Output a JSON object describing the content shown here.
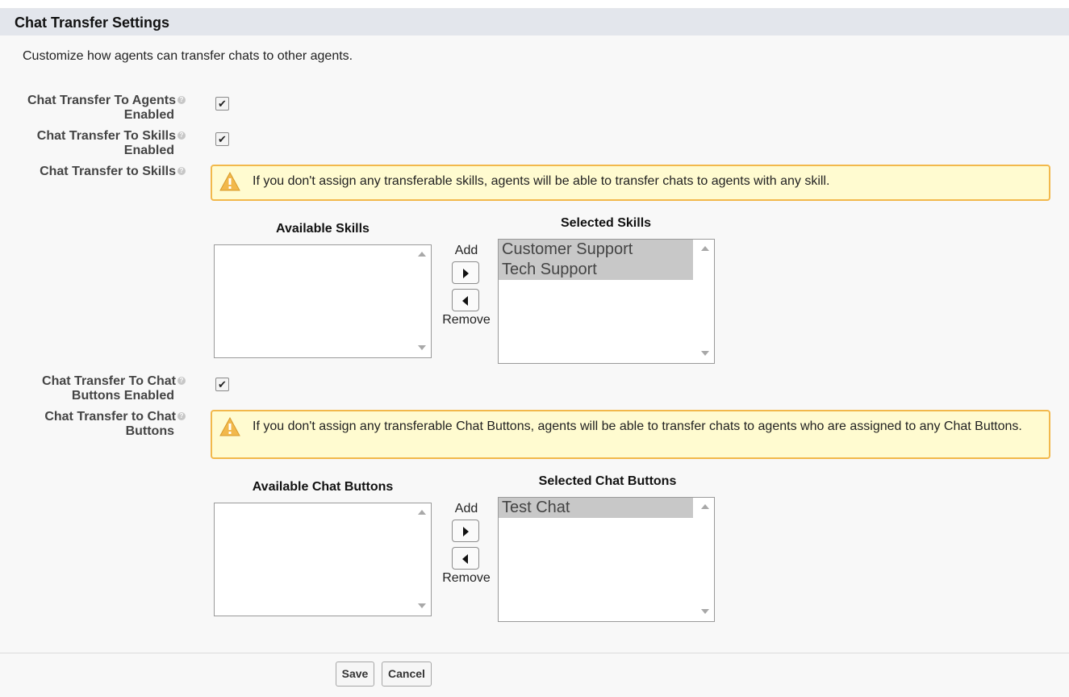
{
  "section": {
    "title": "Chat Transfer Settings",
    "description": "Customize how agents can transfer chats to other agents."
  },
  "fields": {
    "agents_enabled": {
      "label_line1": "Chat Transfer To Agents",
      "label_line2": "Enabled",
      "checked": true
    },
    "skills_enabled": {
      "label_line1": "Chat Transfer To Skills",
      "label_line2": "Enabled",
      "checked": true
    },
    "skills": {
      "label": "Chat Transfer to Skills"
    },
    "buttons_enabled": {
      "label_line1": "Chat Transfer To Chat",
      "label_line2": "Buttons Enabled",
      "checked": true
    },
    "buttons": {
      "label_line1": "Chat Transfer to Chat",
      "label_line2": "Buttons"
    }
  },
  "warnings": {
    "skills": "If you don't assign any transferable skills, agents will be able to transfer chats to agents with any skill.",
    "buttons": "If you don't assign any transferable Chat Buttons, agents will be able to transfer chats to agents who are assigned to any Chat Buttons."
  },
  "skills_picker": {
    "available_title": "Available Skills",
    "selected_title": "Selected Skills",
    "available": [],
    "selected": [
      "Customer Support",
      "Tech Support"
    ],
    "add_label": "Add",
    "remove_label": "Remove"
  },
  "buttons_picker": {
    "available_title": "Available Chat Buttons",
    "selected_title": "Selected Chat Buttons",
    "available": [],
    "selected": [
      "Test Chat"
    ],
    "add_label": "Add",
    "remove_label": "Remove"
  },
  "footer": {
    "save_label": "Save",
    "cancel_label": "Cancel"
  },
  "colors": {
    "header_bg": "#e3e6ec",
    "warning_bg": "#fffbd0",
    "warning_border": "#f2b84b",
    "warning_icon": "#f2b84b",
    "selected_option_bg": "#c8c8c8"
  },
  "icons": {
    "help": "help-icon",
    "warning": "warning-icon",
    "check": "checkmark-icon",
    "add": "right-arrow-icon",
    "remove": "left-arrow-icon"
  }
}
